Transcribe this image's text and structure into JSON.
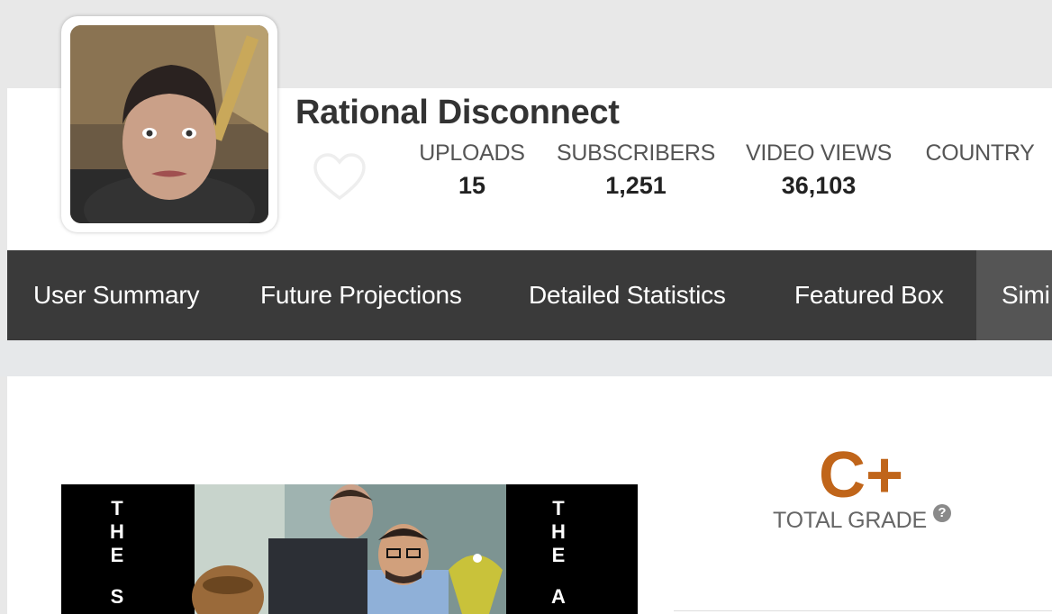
{
  "channel": {
    "name": "Rational Disconnect"
  },
  "stats": [
    {
      "label": "UPLOADS",
      "value": "15"
    },
    {
      "label": "SUBSCRIBERS",
      "value": "1,251"
    },
    {
      "label": "VIDEO VIEWS",
      "value": "36,103"
    },
    {
      "label": "COUNTRY",
      "value": ""
    }
  ],
  "nav": {
    "items": [
      {
        "label": "User Summary"
      },
      {
        "label": "Future Projections"
      },
      {
        "label": "Detailed Statistics"
      },
      {
        "label": "Featured Box"
      },
      {
        "label": "Simi"
      }
    ]
  },
  "grade": {
    "value": "C+",
    "label": "TOTAL GRADE",
    "help": "?"
  },
  "video": {
    "left_letters": [
      "T",
      "H",
      "E",
      "S"
    ],
    "right_letters": [
      "T",
      "H",
      "E",
      "A"
    ]
  },
  "colors": {
    "nav_bg": "#3a3a3a",
    "nav_active_bg": "#555555",
    "grade_accent": "#c0651a"
  },
  "icons": {
    "favorite": "heart-icon",
    "help": "question-circle-icon"
  }
}
